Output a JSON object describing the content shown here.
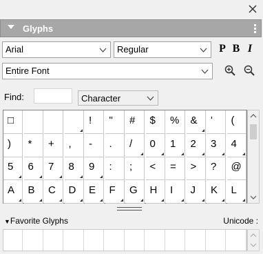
{
  "panel": {
    "title": "Glyphs"
  },
  "font_family": {
    "value": "Arial"
  },
  "font_style": {
    "value": "Regular"
  },
  "style_buttons": {
    "plain": "P",
    "bold": "B",
    "italic": "I"
  },
  "subset": {
    "value": "Entire Font"
  },
  "find": {
    "label": "Find:",
    "value": "",
    "mode": "Character"
  },
  "glyphs": [
    [
      "□",
      "",
      "",
      "",
      "!",
      "\"",
      "#",
      "$",
      "%",
      "&",
      "'",
      "("
    ],
    [
      ")",
      "*",
      "+",
      ",",
      "-",
      ".",
      "/",
      "0",
      "1",
      "2",
      "3",
      "4"
    ],
    [
      "5",
      "6",
      "7",
      "8",
      "9",
      ":",
      ";",
      "<",
      "=",
      ">",
      "?",
      "@"
    ],
    [
      "A",
      "B",
      "C",
      "D",
      "E",
      "F",
      "G",
      "H",
      "I",
      "J",
      "K",
      "L"
    ]
  ],
  "glyph_alternates": [
    [
      false,
      false,
      false,
      true,
      false,
      false,
      false,
      false,
      false,
      true,
      false,
      false
    ],
    [
      false,
      false,
      false,
      false,
      false,
      false,
      true,
      true,
      true,
      true,
      true,
      true
    ],
    [
      true,
      true,
      true,
      true,
      true,
      false,
      false,
      false,
      false,
      false,
      false,
      false
    ],
    [
      true,
      true,
      true,
      true,
      true,
      true,
      true,
      true,
      true,
      true,
      true,
      true
    ]
  ],
  "favorites": {
    "label": "Favorite Glyphs",
    "unicode_label": "Unicode :"
  },
  "icons": {
    "close": "close-icon",
    "panel_menu": "panel-menu-icon",
    "zoom_in": "zoom-in-icon",
    "zoom_out": "zoom-out-icon",
    "dropdown": "chevron-down-icon"
  },
  "colors": {
    "header": "#a7a7a7",
    "background": "#f0f0f0"
  }
}
